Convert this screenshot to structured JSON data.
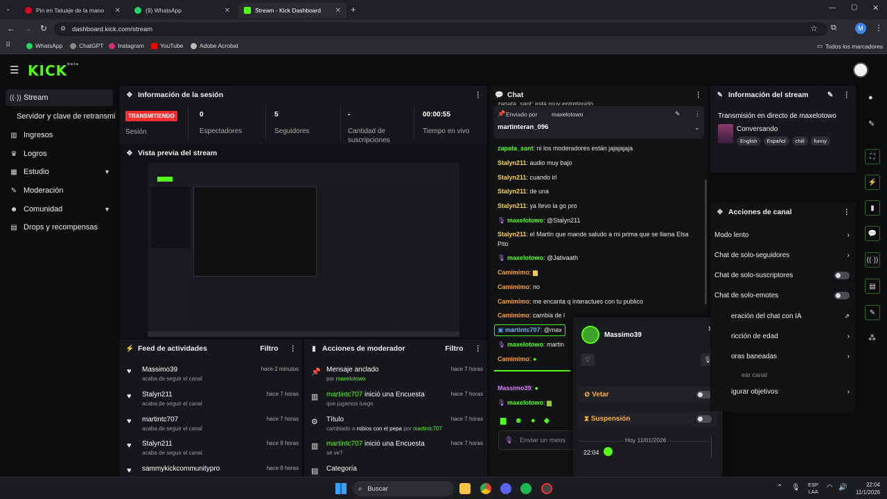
{
  "browser": {
    "tabs": [
      {
        "title": "Pin en Tatuaje de la mano",
        "active": false
      },
      {
        "title": "(9) WhatsApp",
        "active": false
      },
      {
        "title": "Stream - Kick Dashboard",
        "active": true
      }
    ],
    "url": "dashboard.kick.com/stream",
    "bookmarks": [
      "WhatsApp",
      "ChatGPT",
      "Instagram",
      "YouTube",
      "Adobe Acrobat"
    ],
    "all_bookmarks": "Todos los marcadores",
    "profile_initial": "M"
  },
  "app": {
    "logo": "KICK",
    "logo_sup": "beta"
  },
  "sidebar": {
    "items": [
      {
        "label": "Stream",
        "icon": "stream-icon"
      },
      {
        "label": "Servidor y clave de retransmi",
        "icon": ""
      },
      {
        "label": "Ingresos",
        "icon": "chart-icon"
      },
      {
        "label": "Logros",
        "icon": "trophy-icon"
      },
      {
        "label": "Estudio",
        "icon": "grid-icon"
      },
      {
        "label": "Moderación",
        "icon": "wrench-icon"
      },
      {
        "label": "Comunidad",
        "icon": "people-icon"
      },
      {
        "label": "Drops y recompensas",
        "icon": "gift-icon"
      }
    ]
  },
  "session": {
    "title": "Información de la sesión",
    "badge": "TRANSMITIENDO",
    "session_label": "Sesión",
    "stats": [
      {
        "value": "0",
        "label": "Espectadores"
      },
      {
        "value": "5",
        "label": "Seguidores"
      },
      {
        "value": "-",
        "label": "Cantidad de suscripciones"
      },
      {
        "value": "00:00:55",
        "label": "Tiempo en vivo"
      }
    ]
  },
  "preview": {
    "title": "Vista previa del stream"
  },
  "feed": {
    "title": "Feed de actividades",
    "filter": "Filtro",
    "rows": [
      {
        "name": "Massimo39",
        "sub": "acaba de seguir el canal",
        "time": "hace 2 minutos"
      },
      {
        "name": "Stalyn211",
        "sub": "acaba de seguir el canal",
        "time": "hace 7 horas"
      },
      {
        "name": "martintc707",
        "sub": "acaba de seguir el canal",
        "time": "hace 7 horas"
      },
      {
        "name": "Stalyn211",
        "sub": "acaba de seguir el canal",
        "time": "hace 9 horas"
      },
      {
        "name": "sammykickcommunitypro",
        "sub": "",
        "time": "hace 9 horas"
      }
    ]
  },
  "modactions": {
    "title": "Acciones de moderador",
    "filter": "Filtro",
    "rows": [
      {
        "name": "Mensaje anclado",
        "sub_pre": "por ",
        "sub_user": "maxelotowo",
        "time": "hace 7 horas"
      },
      {
        "name_user": "martintc707",
        "name": " inició una Encuesta",
        "sub": "que jugamos luego",
        "time": "hace 7 horas"
      },
      {
        "name": "Título",
        "sub_pre": "cambiado a ",
        "sub_mid": "robios con el pepa",
        "sub_post": " por ",
        "sub_user": "martintc707",
        "time": "hace 7 horas"
      },
      {
        "name_user": "martintc707",
        "name": " inició una Encuesta",
        "sub": "se ve?",
        "time": "hace 7 horas"
      },
      {
        "name": "Categoría",
        "sub": "",
        "time": ""
      }
    ]
  },
  "chat": {
    "title": "Chat",
    "top_cut": "zapata_sant: esta muy entretenido",
    "pinned_by_pre": "Enviado por",
    "pinned_by": "maxelotowo",
    "pinned_user": "martinteran_096",
    "lines": [
      {
        "user": "zapata_sant",
        "text": ": ni los moderadores están jajajajaja",
        "cls": "u-green"
      },
      {
        "user": "Stalyn211",
        "text": ": audio muy bajo",
        "cls": "u-yel"
      },
      {
        "user": "Stalyn211",
        "text": ": cuando irl",
        "cls": "u-yel"
      },
      {
        "user": "Stalyn211",
        "text": ": de una",
        "cls": "u-yel"
      },
      {
        "user": "Stalyn211",
        "text": ": ya llevo la go pro",
        "cls": "u-yel"
      },
      {
        "user": "maxelotowo",
        "text": ": @Stalyn211",
        "cls": "u-green"
      },
      {
        "user": "Stalyn211",
        "text": ": el Martin que mande saludo a mi prima que se llama Elsa",
        "cls": "u-yel"
      },
      {
        "user": "",
        "text": "Pito",
        "cls": ""
      },
      {
        "user": "maxelotowo",
        "text": ": @Jativaath",
        "cls": "u-green"
      },
      {
        "user": "Camimimo",
        "text": ": ",
        "cls": "u-orange"
      },
      {
        "user": "Camimimo",
        "text": ": no",
        "cls": "u-orange"
      },
      {
        "user": "Camimimo",
        "text": ": me encanta q interactues con tu publico",
        "cls": "u-orange"
      },
      {
        "user": "Camimimo",
        "text": ": cambia de l",
        "cls": "u-orange"
      },
      {
        "user": "martintc707",
        "text": ": @max",
        "cls": "u-blue"
      },
      {
        "user": "maxelotowo",
        "text": ": martin",
        "cls": "u-green"
      },
      {
        "user": "Camimimo",
        "text": ": ",
        "cls": "u-orange"
      },
      {
        "user": "Massimo39",
        "text": ": ",
        "cls": "u-pink"
      },
      {
        "user": "maxelotowo",
        "text": ": ",
        "cls": "u-green"
      }
    ],
    "input_placeholder": "Enviar un mens"
  },
  "popup": {
    "username": "Massimo39",
    "ban_label": "Vetar",
    "timeout_label": "Suspensión",
    "date_label": "Hoy 11/01/2026",
    "msg_time": "22:04"
  },
  "streaminfo": {
    "title": "Información del stream",
    "stream_title": "Transmisión en directo de maxelotowo",
    "category": "Conversando",
    "tags": [
      "English",
      "Español",
      "chill",
      "funny"
    ]
  },
  "channel_actions": {
    "title": "Acciones de canal",
    "rows": [
      {
        "label": "Modo lento",
        "ctrl": "chevron"
      },
      {
        "label": "Chat de solo-seguidores",
        "ctrl": "chevron"
      },
      {
        "label": "Chat de solo-suscriptores",
        "ctrl": "toggle"
      },
      {
        "label": "Chat de solo-emotes",
        "ctrl": "toggle"
      },
      {
        "label": "eración del chat con IA",
        "ctrl": "external"
      },
      {
        "label": "ricción de edad",
        "ctrl": "chevron"
      },
      {
        "label": "oras baneadas",
        "ctrl": "chevron"
      },
      {
        "label": "ear canal",
        "ctrl": "none"
      },
      {
        "label": "igurar objetivos",
        "ctrl": "chevron"
      }
    ]
  },
  "taskbar": {
    "search": "Buscar",
    "lang_top": "ESP",
    "lang_bottom": "LAA",
    "time": "22:04",
    "date": "11/1/2026"
  },
  "colors": {
    "kick_green": "#53fc18",
    "live_red": "#ff2d2d",
    "panel_bg": "#16171a",
    "page_bg": "#0b0c0e"
  }
}
